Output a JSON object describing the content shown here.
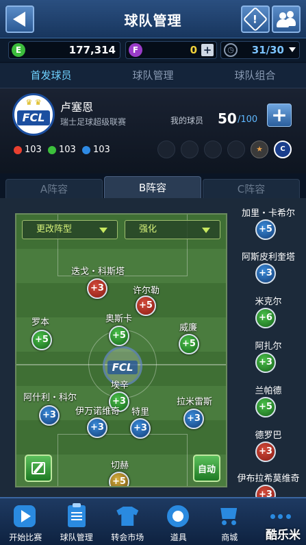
{
  "header": {
    "title": "球队管理"
  },
  "currency": {
    "e_value": "177,314",
    "f_value": "0",
    "energy": "31/30"
  },
  "tabs": [
    "首发球员",
    "球队管理",
    "球队组合"
  ],
  "club": {
    "name": "卢塞恩",
    "league": "瑞士足球超级联赛",
    "badge_text": "FCL",
    "my_players_label": "我的球员",
    "my_players_count": "50",
    "my_players_max": "/100",
    "stat_red": "103",
    "stat_green": "103",
    "stat_blue": "103"
  },
  "formation_tabs": [
    "A阵容",
    "B阵容",
    "C阵容"
  ],
  "pitch": {
    "change_formation": "更改阵型",
    "strengthen": "强化",
    "auto_label": "自动",
    "players": [
      {
        "name": "迭戈・科斯塔",
        "bonus": "+3",
        "color": "red"
      },
      {
        "name": "许尔勒",
        "bonus": "+5",
        "color": "red"
      },
      {
        "name": "罗本",
        "bonus": "+5",
        "color": "green"
      },
      {
        "name": "奥斯卡",
        "bonus": "+5",
        "color": "green"
      },
      {
        "name": "威廉",
        "bonus": "+5",
        "color": "green"
      },
      {
        "name": "埃辛",
        "bonus": "+3",
        "color": "green"
      },
      {
        "name": "阿什利・科尔",
        "bonus": "+3",
        "color": "blue"
      },
      {
        "name": "伊万诺维奇",
        "bonus": "+3",
        "color": "blue"
      },
      {
        "name": "特里",
        "bonus": "+3",
        "color": "blue"
      },
      {
        "name": "拉米雷斯",
        "bonus": "+3",
        "color": "blue"
      },
      {
        "name": "切赫",
        "bonus": "+5",
        "color": "gold"
      }
    ]
  },
  "subs": [
    {
      "name": "加里・卡希尔",
      "bonus": "+5",
      "color": "blue"
    },
    {
      "name": "阿斯皮利奎塔",
      "bonus": "+3",
      "color": "blue"
    },
    {
      "name": "米克尔",
      "bonus": "+6",
      "color": "green"
    },
    {
      "name": "阿扎尔",
      "bonus": "+3",
      "color": "green"
    },
    {
      "name": "兰帕德",
      "bonus": "+5",
      "color": "green"
    },
    {
      "name": "德罗巴",
      "bonus": "+3",
      "color": "red"
    },
    {
      "name": "伊布拉希莫维奇",
      "bonus": "+3",
      "color": "red"
    }
  ],
  "nav": [
    "开始比赛",
    "球队管理",
    "转会市场",
    "道具",
    "商城",
    ""
  ],
  "watermark": "酷乐米"
}
